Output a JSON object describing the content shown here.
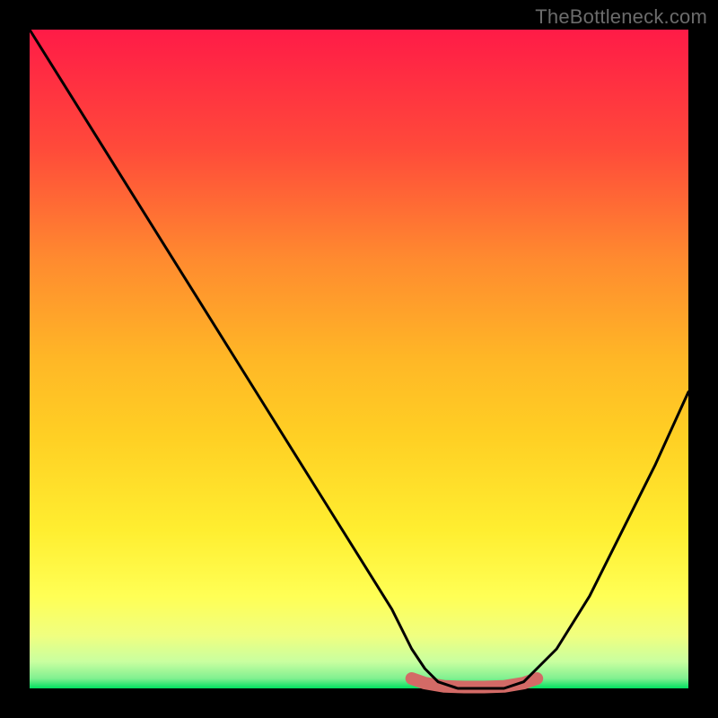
{
  "watermark": "TheBottleneck.com",
  "chart_data": {
    "type": "line",
    "title": "",
    "xlabel": "",
    "ylabel": "",
    "xlim": [
      0,
      100
    ],
    "ylim": [
      0,
      100
    ],
    "grid": false,
    "legend": false,
    "background_gradient": {
      "top": "#ff1b47",
      "upper_mid": "#ff8b2f",
      "mid": "#ffd024",
      "lower_mid": "#ffff40",
      "near_bottom": "#e8ff90",
      "bottom": "#00e060"
    },
    "series": [
      {
        "name": "bottleneck-curve",
        "color": "#000000",
        "x": [
          0,
          5,
          10,
          15,
          20,
          25,
          30,
          35,
          40,
          45,
          50,
          55,
          58,
          60,
          62,
          65,
          68,
          70,
          72,
          75,
          80,
          85,
          90,
          95,
          100
        ],
        "y": [
          100,
          92,
          84,
          76,
          68,
          60,
          52,
          44,
          36,
          28,
          20,
          12,
          6,
          3,
          1,
          0,
          0,
          0,
          0,
          1,
          6,
          14,
          24,
          34,
          45
        ]
      },
      {
        "name": "bottleneck-low-band",
        "color": "#d36a66",
        "x": [
          58,
          60,
          63,
          66,
          69,
          72,
          75,
          77
        ],
        "y": [
          1.5,
          0.8,
          0.3,
          0.2,
          0.2,
          0.3,
          0.8,
          1.5
        ]
      }
    ],
    "annotations": []
  }
}
